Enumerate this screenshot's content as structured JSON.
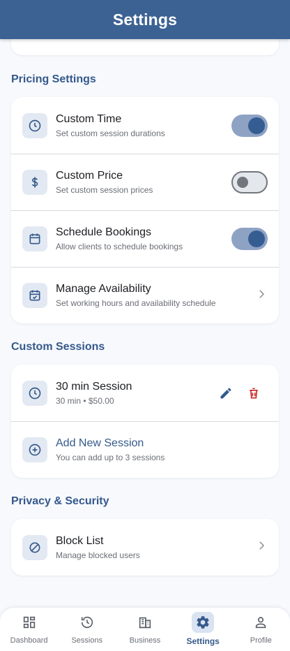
{
  "header": {
    "title": "Settings"
  },
  "pricing": {
    "title": "Pricing Settings",
    "custom_time": {
      "title": "Custom Time",
      "subtitle": "Set custom session durations",
      "enabled": true
    },
    "custom_price": {
      "title": "Custom Price",
      "subtitle": "Set custom session prices",
      "enabled": false
    },
    "schedule": {
      "title": "Schedule Bookings",
      "subtitle": "Allow clients to schedule bookings",
      "enabled": true
    },
    "availability": {
      "title": "Manage Availability",
      "subtitle": "Set working hours and availability schedule"
    }
  },
  "sessions": {
    "title": "Custom Sessions",
    "items": [
      {
        "title": "30 min Session",
        "subtitle": "30 min • $50.00"
      }
    ],
    "add": {
      "title": "Add New Session",
      "subtitle": "You can add up to 3 sessions"
    }
  },
  "privacy": {
    "title": "Privacy & Security",
    "block_list": {
      "title": "Block List",
      "subtitle": "Manage blocked users"
    }
  },
  "nav": {
    "items": [
      {
        "label": "Dashboard",
        "icon": "dashboard-icon"
      },
      {
        "label": "Sessions",
        "icon": "history-icon"
      },
      {
        "label": "Business",
        "icon": "business-icon"
      },
      {
        "label": "Settings",
        "icon": "gear-icon",
        "active": true
      },
      {
        "label": "Profile",
        "icon": "person-icon"
      }
    ]
  },
  "colors": {
    "primary": "#3c6293",
    "accent": "#35598b",
    "delete": "#c62828",
    "background": "#f7f9fd"
  }
}
